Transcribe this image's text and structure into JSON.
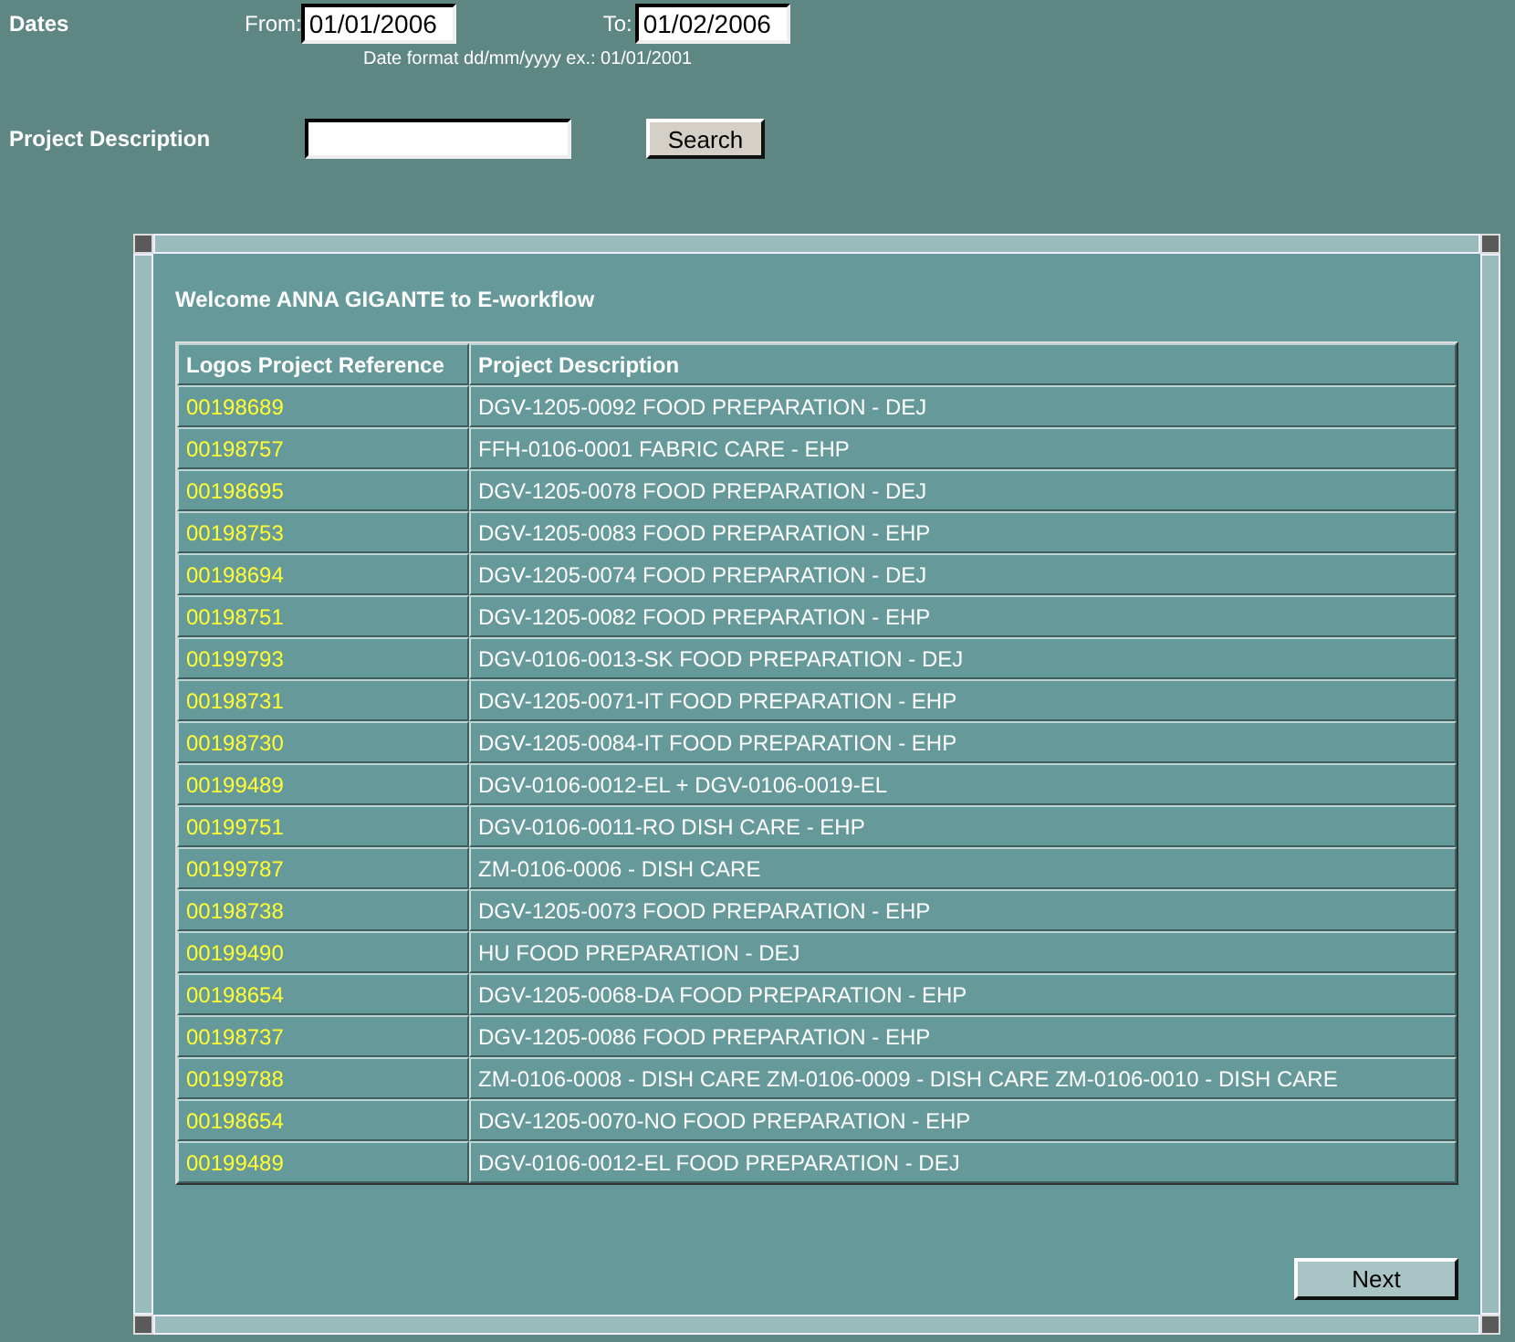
{
  "search_form": {
    "dates_label": "Dates",
    "from_label": "From:",
    "from_value": "01/01/2006",
    "to_label": "To:",
    "to_value": "01/02/2006",
    "date_hint": "Date format dd/mm/yyyy ex.: 01/01/2001",
    "description_label": "Project Description",
    "search_button": "Search"
  },
  "panel": {
    "welcome": "Welcome ANNA GIGANTE to E-workflow",
    "table": {
      "columns": [
        "Logos Project Reference",
        "Project Description"
      ],
      "rows": [
        {
          "reference": "00198689",
          "description": "DGV-1205-0092 FOOD PREPARATION - DEJ"
        },
        {
          "reference": "00198757",
          "description": "FFH-0106-0001 FABRIC CARE - EHP"
        },
        {
          "reference": "00198695",
          "description": "DGV-1205-0078 FOOD PREPARATION - DEJ"
        },
        {
          "reference": "00198753",
          "description": "DGV-1205-0083 FOOD PREPARATION - EHP"
        },
        {
          "reference": "00198694",
          "description": "DGV-1205-0074 FOOD PREPARATION - DEJ"
        },
        {
          "reference": "00198751",
          "description": "DGV-1205-0082 FOOD PREPARATION - EHP"
        },
        {
          "reference": "00199793",
          "description": "DGV-0106-0013-SK FOOD PREPARATION - DEJ"
        },
        {
          "reference": "00198731",
          "description": "DGV-1205-0071-IT FOOD PREPARATION - EHP"
        },
        {
          "reference": "00198730",
          "description": "DGV-1205-0084-IT FOOD PREPARATION - EHP"
        },
        {
          "reference": "00199489",
          "description": "DGV-0106-0012-EL + DGV-0106-0019-EL"
        },
        {
          "reference": "00199751",
          "description": "DGV-0106-0011-RO DISH CARE - EHP"
        },
        {
          "reference": "00199787",
          "description": "ZM-0106-0006 - DISH CARE"
        },
        {
          "reference": "00198738",
          "description": "DGV-1205-0073 FOOD PREPARATION - EHP"
        },
        {
          "reference": "00199490",
          "description": "HU FOOD PREPARATION - DEJ"
        },
        {
          "reference": "00198654",
          "description": "DGV-1205-0068-DA FOOD PREPARATION - EHP"
        },
        {
          "reference": "00198737",
          "description": "DGV-1205-0086 FOOD PREPARATION - EHP"
        },
        {
          "reference": "00199788",
          "description": "ZM-0106-0008 - DISH CARE ZM-0106-0009 - DISH CARE ZM-0106-0010 - DISH CARE"
        },
        {
          "reference": "00198654",
          "description": "DGV-1205-0070-NO FOOD PREPARATION - EHP"
        },
        {
          "reference": "00199489",
          "description": "DGV-0106-0012-EL FOOD PREPARATION - DEJ"
        }
      ]
    },
    "next_button": "Next"
  }
}
